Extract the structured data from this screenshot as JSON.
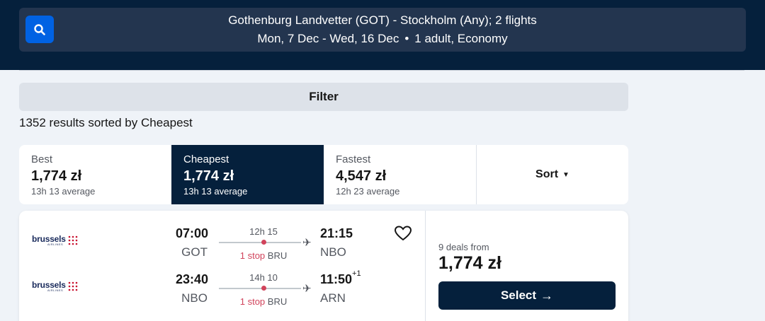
{
  "search": {
    "route": "Gothenburg Landvetter (GOT) - Stockholm (Any); 2 flights",
    "dates": "Mon, 7 Dec - Wed, 16 Dec",
    "passengers": "1 adult, Economy",
    "separator": "•"
  },
  "filter": {
    "label": "Filter"
  },
  "results": {
    "summary": "1352 results sorted by Cheapest"
  },
  "tabs": [
    {
      "label": "Best",
      "price": "1,774 zł",
      "avg": "13h 13 average"
    },
    {
      "label": "Cheapest",
      "price": "1,774 zł",
      "avg": "13h 13 average"
    },
    {
      "label": "Fastest",
      "price": "4,547 zł",
      "avg": "12h 23 average"
    }
  ],
  "sort": {
    "label": "Sort",
    "caret": "▼"
  },
  "card": {
    "legs": [
      {
        "airline": "brussels",
        "airline_sub": "AIRLINES",
        "dep_time": "07:00",
        "dep_code": "GOT",
        "duration": "12h 15",
        "stops": "1 stop",
        "stop_code": "BRU",
        "arr_time": "21:15",
        "arr_suffix": "",
        "arr_code": "NBO"
      },
      {
        "airline": "brussels",
        "airline_sub": "AIRLINES",
        "dep_time": "23:40",
        "dep_code": "NBO",
        "duration": "14h 10",
        "stops": "1 stop",
        "stop_code": "BRU",
        "arr_time": "11:50",
        "arr_suffix": "+1",
        "arr_code": "ARN"
      }
    ],
    "deals": "9 deals from",
    "price": "1,774 zł",
    "select": "Select",
    "select_arrow": "→",
    "plane_glyph": "✈"
  },
  "colors": {
    "header_bg": "#05203c",
    "accent_blue": "#0062e3",
    "stop_red": "#d1435b"
  }
}
